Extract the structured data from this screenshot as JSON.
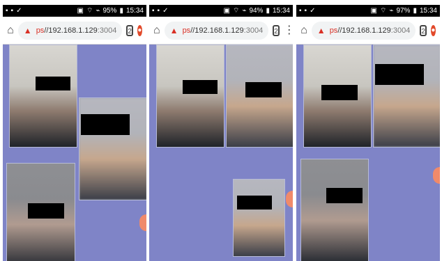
{
  "screens": [
    {
      "status": {
        "left_icons": [
          "notification-icon",
          "camera-icon",
          "check-icon"
        ],
        "battery": "95%",
        "time": "15:34"
      },
      "browser": {
        "home_icon": "home-icon",
        "warning_icon": "warning-icon",
        "scheme": "ps",
        "host": "//192.168.1.129",
        "port": ":3004",
        "tab_count": "2",
        "right_icon": "brand-badge-icon"
      }
    },
    {
      "status": {
        "left_icons": [
          "notification-icon",
          "camera-icon",
          "check-icon"
        ],
        "battery": "94%",
        "time": "15:34"
      },
      "browser": {
        "home_icon": "home-icon",
        "warning_icon": "warning-icon",
        "scheme": "ps",
        "host": "//192.168.1.129",
        "port": ":3004",
        "tab_count": "2",
        "right_icon": "more-vert-icon"
      }
    },
    {
      "status": {
        "left_icons": [
          "notification-icon",
          "camera-icon",
          "check-icon"
        ],
        "battery": "97%",
        "time": "15:34"
      },
      "browser": {
        "home_icon": "home-icon",
        "warning_icon": "warning-icon",
        "scheme": "ps",
        "host": "//192.168.1.129",
        "port": ":3004",
        "tab_count": "2",
        "right_icon": "brand-badge-icon"
      }
    }
  ],
  "glyphs": {
    "signal": "⌁",
    "wifi": "⌔",
    "battery": "▮",
    "home": "⌂",
    "warning": "▲",
    "more": "⋮",
    "badge": "●"
  }
}
